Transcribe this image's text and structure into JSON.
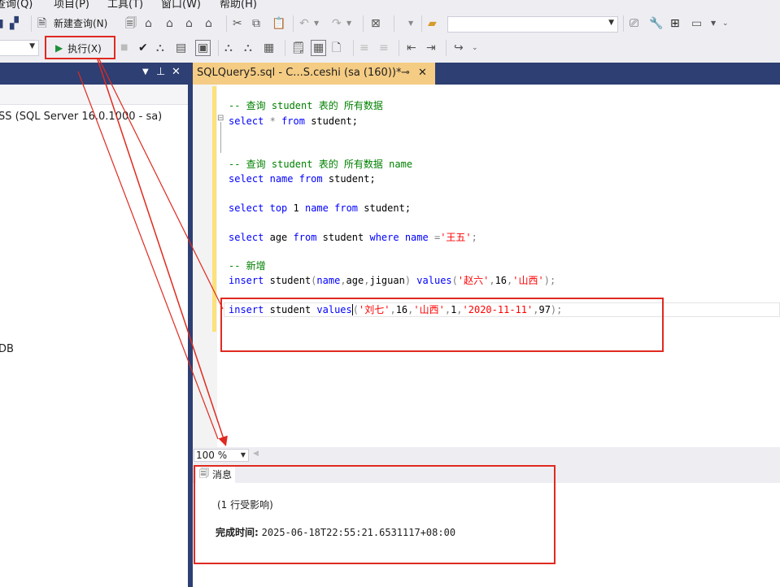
{
  "menu": [
    "查询(Q)",
    "项目(P)",
    "工具(T)",
    "窗口(W)",
    "帮助(H)"
  ],
  "toolbar1": {
    "new_query_label": "新建查询(N)"
  },
  "toolbar2": {
    "execute_label": "执行(X)"
  },
  "object_explorer": {
    "server_node": "SS (SQL Server 16.0.1000 - sa)",
    "db_node": "DB"
  },
  "document_tab": {
    "title": "SQLQuery5.sql - C...S.ceshi (sa (160))*",
    "pin": "⊸",
    "close": "✕"
  },
  "editor": {
    "comment1": "-- 查询 student 表的 所有数据",
    "kw_select1": "select",
    "star": "*",
    "kw_from1": "from",
    "tbl1": "student;",
    "comment2": "-- 查询 student 表的 所有数据 name",
    "kw_select2": "select",
    "col_name2": "name",
    "kw_from2": "from",
    "tbl2": "student;",
    "kw_select3": "select",
    "kw_top": "top",
    "top_n": "1",
    "col_name3": "name",
    "kw_from3": "from",
    "tbl3": "student;",
    "kw_select4": "select",
    "col_age4": "age",
    "kw_from4": "from",
    "tbl4": "student",
    "kw_where4": "where",
    "col_name4": "name",
    "op4": "=",
    "str4": "'王五'",
    "semi4": ";",
    "comment5": "-- 新增",
    "kw_insert5": "insert",
    "tbl5": "student",
    "cols5_open": "(",
    "col5a": "name",
    "comma5a": ",",
    "col5b": "age",
    "comma5b": ",",
    "col5c": "jiguan",
    "cols5_close": ")",
    "kw_values5": "values",
    "paren5_open": "(",
    "str5a": "'赵六'",
    "comma5c": ",",
    "num5": "16",
    "comma5d": ",",
    "str5b": "'山西'",
    "paren5_close": ");",
    "kw_insert6": "insert",
    "tbl6": "student",
    "kw_values6": "values",
    "paren6_open": "(",
    "str6a": "'刘七'",
    "comma6a": ",",
    "num6a": "16",
    "comma6b": ",",
    "str6b": "'山西'",
    "comma6c": ",",
    "num6b": "1",
    "comma6d": ",",
    "str6c": "'2020-11-11'",
    "comma6e": ",",
    "num6c": "97",
    "paren6_close": ");"
  },
  "zoom": {
    "value": "100 %"
  },
  "results": {
    "tab_label": "消息",
    "rows_affected": "(1 行受影响)",
    "completion_label": "完成时间:",
    "completion_time": "2025-06-18T22:55:21.6531117+08:00"
  },
  "colors": {
    "accent_dark": "#2d3f73",
    "tab_active": "#f5cc84",
    "annotation_red": "#e02a20"
  }
}
